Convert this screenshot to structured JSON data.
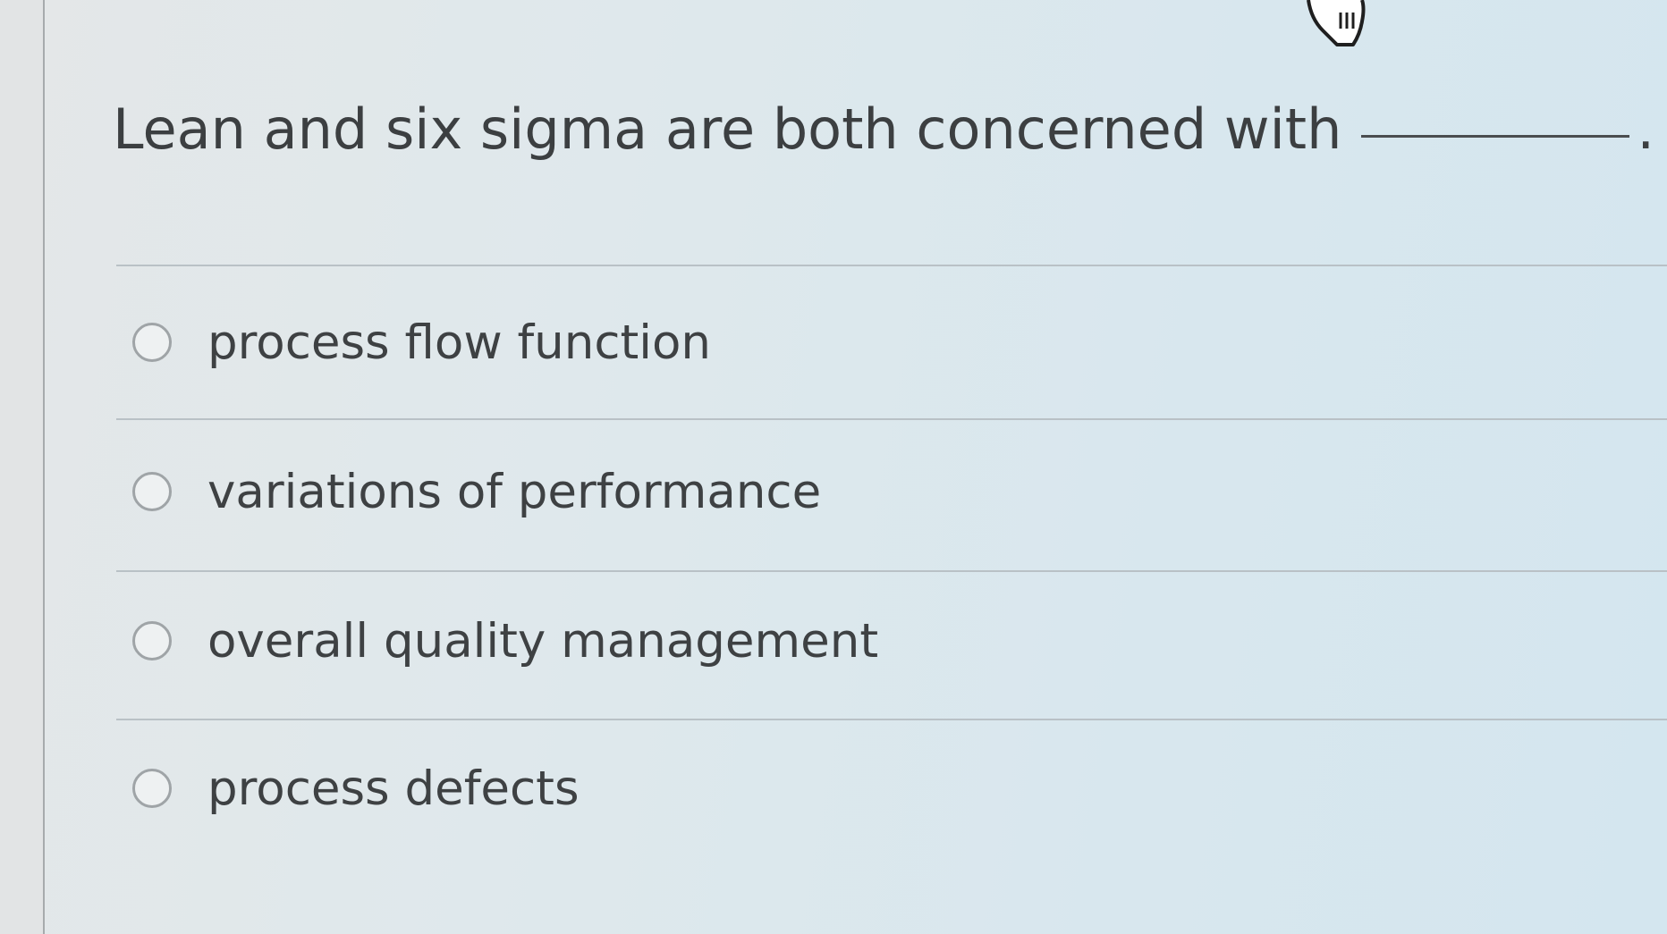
{
  "question": {
    "text": "Lean and six sigma are both concerned with",
    "period": "."
  },
  "cursor": {
    "icon": "hand-pointer-icon"
  },
  "options": [
    {
      "label": "process flow function",
      "selected": false
    },
    {
      "label": "variations of performance",
      "selected": false
    },
    {
      "label": "overall quality management",
      "selected": false
    },
    {
      "label": "process defects",
      "selected": false
    }
  ]
}
